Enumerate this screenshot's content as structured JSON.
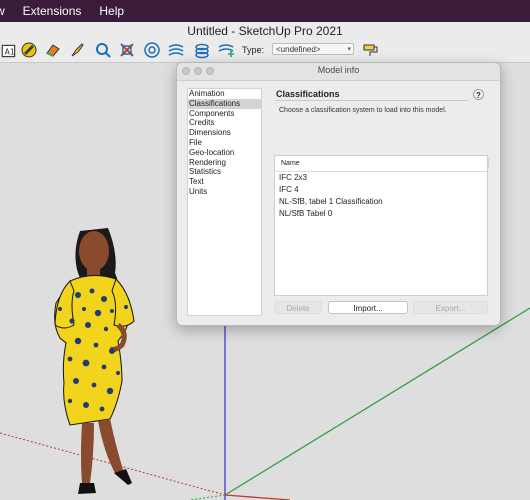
{
  "menubar": {
    "items": [
      "w",
      "Extensions",
      "Help"
    ]
  },
  "window": {
    "title": "Untitled - SketchUp Pro 2021"
  },
  "toolbar": {
    "type_label": "Type:",
    "type_value": "<undefined>",
    "tools": [
      "classifier-icon",
      "paint-bucket-icon",
      "eraser-icon",
      "brush-icon",
      "tape-measure-icon",
      "section-plane-icon",
      "target-icon",
      "stack-icon",
      "layers-icon",
      "layer-add-icon",
      "paint-roller-icon"
    ]
  },
  "dialog": {
    "title": "Model info",
    "categories": [
      "Animation",
      "Classifications",
      "Components",
      "Credits",
      "Dimensions",
      "File",
      "Geo-location",
      "Rendering",
      "Statistics",
      "Text",
      "Units"
    ],
    "selected_category": "Classifications",
    "panel_title": "Classifications",
    "help_label": "?",
    "description": "Choose a classification system to load into this model.",
    "table": {
      "column": "Name",
      "rows": [
        "IFC 2x3",
        "IFC 4",
        "NL-SfB, tabel 1 Classification",
        "NL/SfB Tabel 0"
      ]
    },
    "buttons": {
      "delete": "Delete",
      "import": "Import...",
      "export": "Export..."
    }
  },
  "colors": {
    "menubar_bg": "#3a1c3a",
    "axis_green": "#2ea043",
    "axis_blue": "#3b3bdb",
    "axis_red": "#c0392b",
    "dress_yellow": "#f2d41c",
    "dress_dots": "#1f3b7a",
    "skin": "#8a4a2e"
  }
}
